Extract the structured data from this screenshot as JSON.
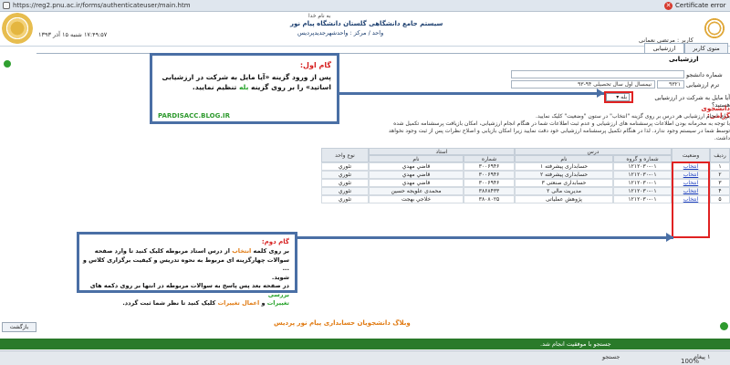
{
  "browser": {
    "url": "https://reg2.pnu.ac.ir/forms/authenticateuser/main.htm",
    "cert_error": "Certificate error"
  },
  "header": {
    "date": "۱۷:۴۹:۵۷ شنبه ۱۵ آذر ۱۳۹۳",
    "line1": "به نام خدا",
    "line2": "سیستم جامع دانشگاهی گلستان    دانشگاه پیام نور",
    "line3": "واحد / مرکز : واحدشهرجدیدپردیس",
    "user": "کاربر : مرتضی نعمانی"
  },
  "tabs": {
    "evaluation": "ارزشیابی",
    "user_menu": "منوی کاربر"
  },
  "form": {
    "title": "ارزشیابی",
    "student_no_label": "شماره دانشجو",
    "evaluation_term_label": "ترم ارزشیابی",
    "term_value": "۹۳۲۱",
    "term_name": "نیمسال اول سال تحصیلی ۹۴-۹۳",
    "question_label": "آیا مایل به شرکت در ارزشیابی هستید؟",
    "answer_value": "بله"
  },
  "notice": {
    "title": "دانشجوی گرامی:",
    "lines": [
      "برای انجام ارزشیابی هر درس بر روی گزینه \"انتخاب\" در ستون \"وضعیت\" کلیک نمایید.",
      "با توجه به محرمانه بودن اطلاعات پرسشنامه های ارزشیابی و عدم ثبت اطلاعات شما در هنگام انجام ارزشیابی، امکان بازیافت پرسشنامه تکمیل شده",
      "توسط شما در سیستم وجود ندارد. لذا در هنگام تکمیل پرسشنامه ارزشیابی خود دقت نمایید زیرا امکان بازیابی و اصلاح نظرات پس از ثبت وجود نخواهد",
      "داشت."
    ]
  },
  "table": {
    "headers": {
      "row": "ردیف",
      "status": "وضعیت",
      "course_group": "درس",
      "code_group": "شماره و گروه",
      "name": "نام",
      "teacher": "استاد",
      "teacher_no": "شماره",
      "teacher_name": "نام",
      "unit_type": "نوع واحد"
    },
    "rows": [
      {
        "status": "انتخاب",
        "code": "۱۲۱۲۰۳۰-۰۱",
        "course": "حسابداری پیشرفته ۱",
        "tno": "۳۰۰۶۹۴۶",
        "tname": "قاضي مهدي",
        "type": "تئوري"
      },
      {
        "status": "انتخاب",
        "code": "۱۲۱۲۰۳۰-۰۱",
        "course": "حسابداری پیشرفته ۲",
        "tno": "۳۰۰۶۹۴۶",
        "tname": "قاضي مهدي",
        "type": "تئوري"
      },
      {
        "status": "انتخاب",
        "code": "۱۲۱۲۰۳۰-۰۱",
        "course": "حسابداری صنعتی ۳",
        "tno": "۳۰۰۶۹۴۶",
        "tname": "قاضي مهدي",
        "type": "تئوري"
      },
      {
        "status": "انتخاب",
        "code": "۱۲۱۲۰۳۰-۰۱",
        "course": "مدیریت مالی ۲",
        "tno": "۳۸۶۸۴۳۳",
        "tname": "محمدی علویجه حسين",
        "type": "تئوري"
      },
      {
        "status": "انتخاب",
        "code": "۱۲۱۲۰۳۰-۰۱",
        "course": "پژوهش عملیاتی",
        "tno": "۳۸۰۸۰۲۵",
        "tname": "خلاجي بهجت",
        "type": "تئوري"
      }
    ]
  },
  "step1": {
    "title": "گام اول:",
    "text_a": "پس از ورود گزینه «آیا مایل به شرکت در ارزشیابی اساتید» را بر روی",
    "text_b": "گزینه",
    "text_yes": "بله",
    "text_c": "تنظیم نمایید.",
    "blog": "PARDISACC.BLOG.IR"
  },
  "step2": {
    "title": "گام دوم:",
    "line1_a": "بر روی کلمه",
    "line1_sel": "انتخاب",
    "line1_b": "از درس استاد مربوطه کلیک کنید تا وارد صفحه",
    "line2": "سوالات چهارگزینه ای مربوط به نحوه تدریس و کیفیت برگزاری کلاس و ...",
    "line3": "شوید.",
    "line4": "در صفحه بعد پس پاسخ به سوالات مربوطه در انتها بر روی دکمه های",
    "review": "بررسی",
    "line5_a": "تغییرات",
    "line5_b": "و",
    "apply": "اعمال تغییرات",
    "line5_c": "کلیک کنید تا نظر شما ثبت گردد."
  },
  "credit": "وبلاگ دانشجویان حسابداری پیام نور پردیس",
  "back_button": "بازگشت",
  "status_message": "جستجو با موفقیت انجام شد.",
  "statusbar": {
    "search": "جستجو",
    "count": "۱ پیغام",
    "zoom": "100%"
  }
}
